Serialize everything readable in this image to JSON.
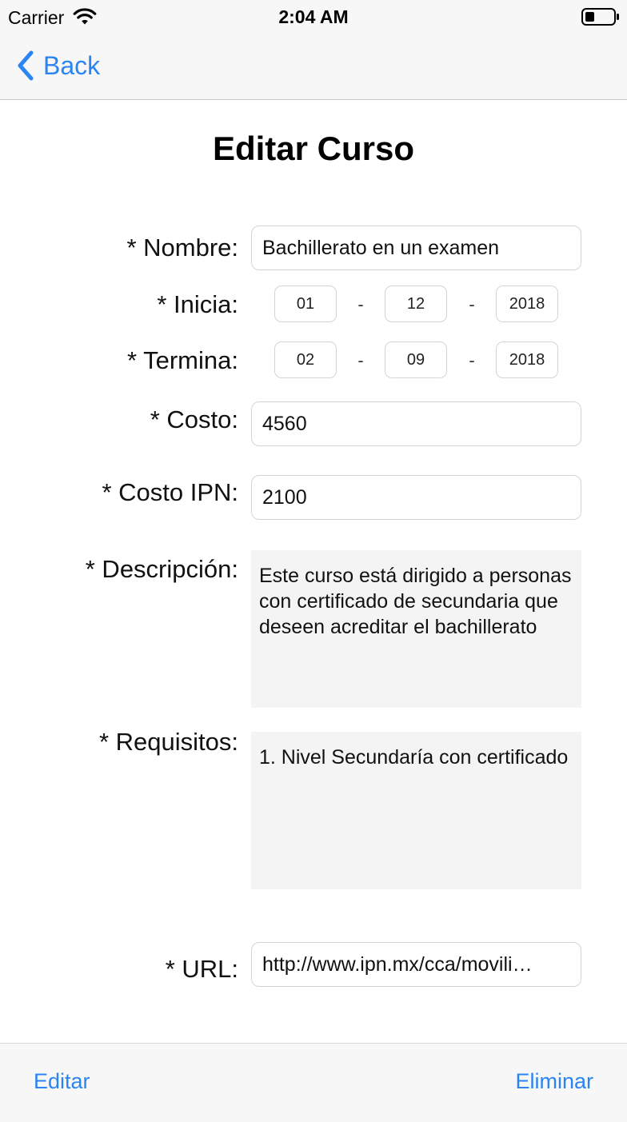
{
  "status_bar": {
    "carrier": "Carrier",
    "time": "2:04 AM",
    "wifi_icon": "wifi-icon",
    "battery_icon": "battery-icon"
  },
  "nav": {
    "back_label": "Back",
    "back_icon": "chevron-left-icon",
    "accent_color": "#2a84f2"
  },
  "page": {
    "title": "Editar Curso"
  },
  "form": {
    "nombre": {
      "label": "* Nombre:",
      "value": "Bachillerato en un examen"
    },
    "inicia": {
      "label": "* Inicia:",
      "day": "01",
      "month": "12",
      "year": "2018",
      "separator": "-"
    },
    "termina": {
      "label": "* Termina:",
      "day": "02",
      "month": "09",
      "year": "2018",
      "separator": "-"
    },
    "costo": {
      "label": "* Costo:",
      "value": "4560"
    },
    "costo_ipn": {
      "label": "* Costo IPN:",
      "value": "2100"
    },
    "descripcion": {
      "label": "* Descripción:",
      "value": "Este curso está dirigido a personas con certificado de secundaria que deseen acreditar el bachillerato"
    },
    "requisitos": {
      "label": "* Requisitos:",
      "value": "1. Nivel Secundaría con certificado"
    },
    "url": {
      "label": "* URL:",
      "value": "http://www.ipn.mx/cca/movili…"
    }
  },
  "toolbar": {
    "edit_label": "Editar",
    "delete_label": "Eliminar"
  }
}
